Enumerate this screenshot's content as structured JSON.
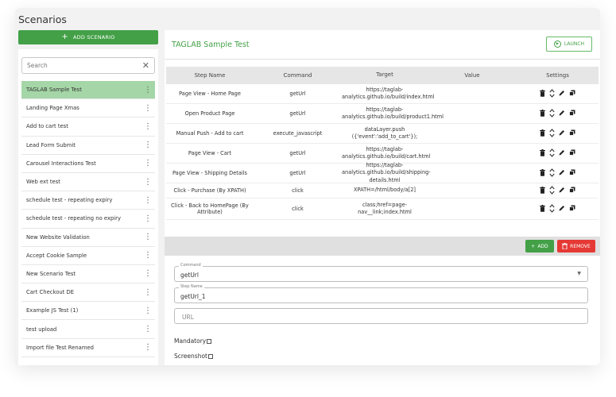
{
  "page": {
    "title": "Scenarios"
  },
  "sidebar": {
    "add_label": "ADD SCENARIO",
    "search_placeholder": "Search",
    "items": [
      {
        "label": "TAGLAB Sample Test"
      },
      {
        "label": "Landing Page Xmas"
      },
      {
        "label": "Add to cart test"
      },
      {
        "label": "Lead Form Submit"
      },
      {
        "label": "Carousel Interactions Test"
      },
      {
        "label": "Web ext test"
      },
      {
        "label": "schedule test - repeating expiry"
      },
      {
        "label": "schedule test - repeating no expiry"
      },
      {
        "label": "New Website Validation"
      },
      {
        "label": "Accept Cookie Sample"
      },
      {
        "label": "New Scenario Test"
      },
      {
        "label": "Cart Checkout DE"
      },
      {
        "label": "Example JS Test (1)"
      },
      {
        "label": "test upload"
      },
      {
        "label": "Import file Test Renamed"
      }
    ]
  },
  "main": {
    "scenario_title": "TAGLAB Sample Test",
    "launch_label": "LAUNCH",
    "columns": [
      "Step Name",
      "Command",
      "Target",
      "Value",
      "Settings"
    ],
    "steps": [
      {
        "name": "Page View - Home Page",
        "command": "getUrl",
        "target": "https://taglab-analytics.github.io/build/index.html",
        "value": ""
      },
      {
        "name": "Open Product Page",
        "command": "getUrl",
        "target": "https://taglab-analytics.github.io/build/product1.html",
        "value": ""
      },
      {
        "name": "Manual Push - Add to cart",
        "command": "execute_javascript",
        "target": "dataLayer.push ({'event':'add_to_cart'});",
        "value": ""
      },
      {
        "name": "Page View - Cart",
        "command": "getUrl",
        "target": "https://taglab-analytics.github.io/build/cart.html",
        "value": ""
      },
      {
        "name": "Page View - Shipping Details",
        "command": "getUrl",
        "target": "https://taglab-analytics.github.io/build/shipping-details.html",
        "value": ""
      },
      {
        "name": "Click - Purchase (By XPATH)",
        "command": "click",
        "target": "XPATH=/html/body/a[2]",
        "value": ""
      },
      {
        "name": "Click - Back to HomePage (By Attribute)",
        "command": "click",
        "target": "class;href=page-nav__link;index.html",
        "value": ""
      }
    ],
    "toolbar": {
      "add_label": "ADD",
      "remove_label": "REMOVE"
    },
    "form": {
      "command_label": "Command",
      "command_value": "getUrl",
      "stepname_label": "Step Name",
      "stepname_value": "getUrl_1",
      "url_placeholder": "URL",
      "mandatory_label": "Mandatory",
      "screenshot_label": "Screenshot"
    }
  },
  "colors": {
    "accent": "#43a047",
    "active_row": "#a5d6a7",
    "danger": "#e53935"
  },
  "icons": {
    "settings_row": [
      "trash-icon",
      "reorder-icon",
      "edit-icon",
      "copy-icon"
    ]
  }
}
